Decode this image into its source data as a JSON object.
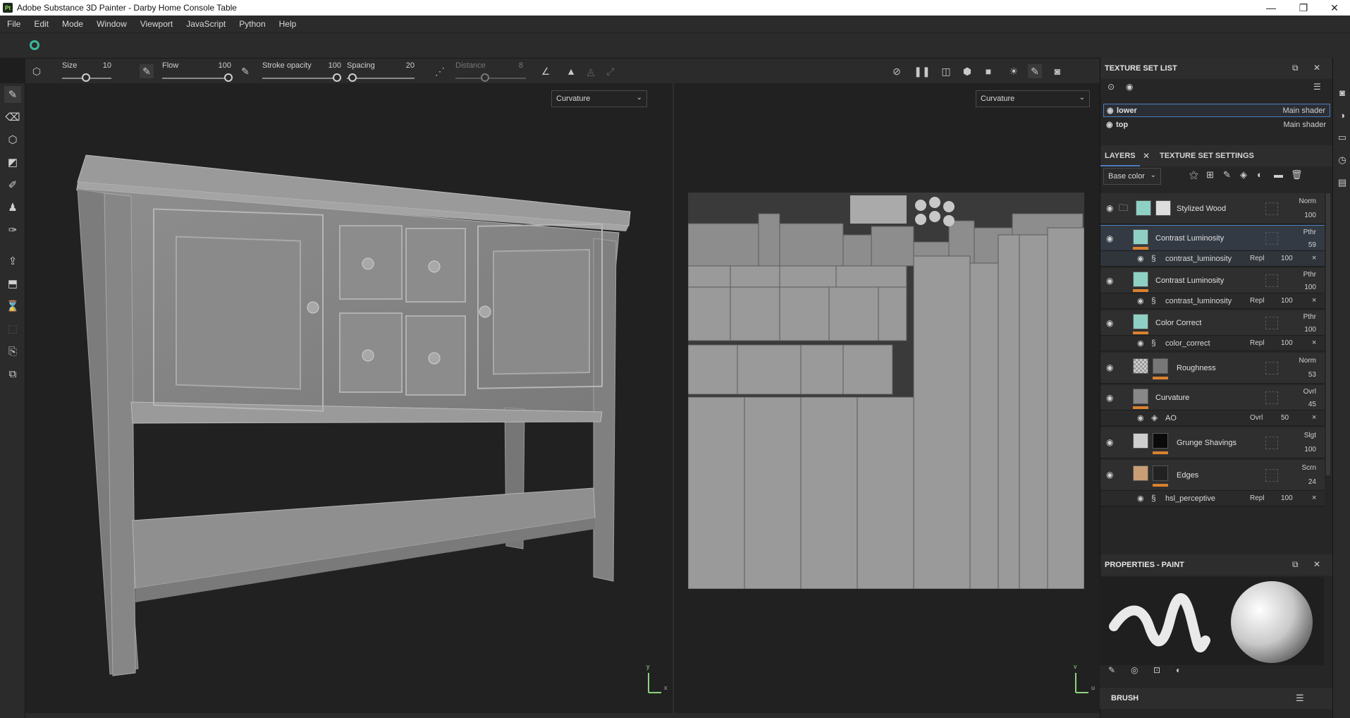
{
  "window": {
    "app_icon": "Pt",
    "title": "Adobe Substance 3D Painter - Darby Home Console Table",
    "controls": [
      "—",
      "❐",
      "✕"
    ]
  },
  "menu": [
    "File",
    "Edit",
    "Mode",
    "Window",
    "Viewport",
    "JavaScript",
    "Python",
    "Help"
  ],
  "tool_options": {
    "size_label": "Size",
    "size_value": "10",
    "flow_label": "Flow",
    "flow_value": "100",
    "stroke_opacity_label": "Stroke opacity",
    "stroke_opacity_value": "100",
    "spacing_label": "Spacing",
    "spacing_value": "20",
    "distance_label": "Distance",
    "distance_value": "8"
  },
  "viewport_3d": {
    "channel": "Curvature",
    "axis_x": "x",
    "axis_y": "y"
  },
  "viewport_2d": {
    "channel": "Curvature",
    "axis_x": "u",
    "axis_y": "v"
  },
  "texture_set_list": {
    "title": "TEXTURE SET LIST",
    "sets": [
      {
        "name": "lower",
        "shader": "Main shader",
        "selected": true
      },
      {
        "name": "top",
        "shader": "Main shader",
        "selected": false
      }
    ]
  },
  "layers_panel": {
    "tab_layers": "LAYERS",
    "tab_settings": "TEXTURE SET SETTINGS",
    "channel": "Base color",
    "layers": [
      {
        "name": "Stylized Wood",
        "blend": "Norm",
        "opacity": "100",
        "type": "folder"
      },
      {
        "name": "Contrast Luminosity",
        "blend": "Pthr",
        "opacity": "59",
        "selected": true,
        "effect": {
          "name": "contrast_luminosity",
          "blend": "Repl",
          "opacity": "100"
        }
      },
      {
        "name": "Contrast Luminosity",
        "blend": "Pthr",
        "opacity": "100",
        "effect": {
          "name": "contrast_luminosity",
          "blend": "Repl",
          "opacity": "100"
        }
      },
      {
        "name": "Color Correct",
        "blend": "Pthr",
        "opacity": "100",
        "effect": {
          "name": "color_correct",
          "blend": "Repl",
          "opacity": "100"
        }
      },
      {
        "name": "Roughness",
        "blend": "Norm",
        "opacity": "53"
      },
      {
        "name": "Curvature",
        "blend": "Ovrl",
        "opacity": "45",
        "effect": {
          "name": "AO",
          "blend": "Ovrl",
          "opacity": "50"
        }
      },
      {
        "name": "Grunge Shavings",
        "blend": "Slgt",
        "opacity": "100"
      },
      {
        "name": "Edges",
        "blend": "Scrn",
        "opacity": "24",
        "effect": {
          "name": "hsl_perceptive",
          "blend": "Repl",
          "opacity": "100"
        }
      }
    ]
  },
  "properties": {
    "title": "PROPERTIES - PAINT",
    "brush_label": "BRUSH"
  },
  "colors": {
    "accent": "#4a7fbf",
    "mask_orange": "#d9812f",
    "teal": "#8fd0c4"
  }
}
